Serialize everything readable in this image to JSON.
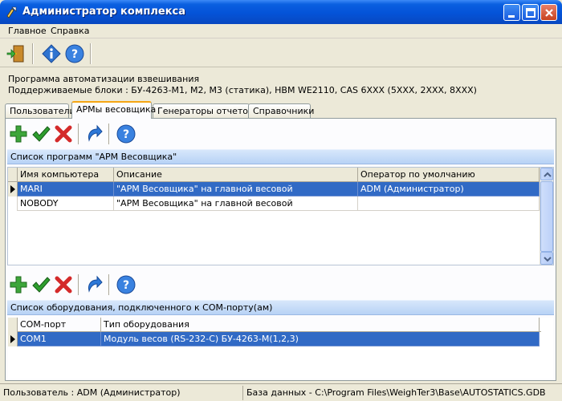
{
  "window": {
    "title": "Администратор комплекса"
  },
  "menu": {
    "items": [
      "Главное",
      "Справка"
    ]
  },
  "info": {
    "line1": "Программа автоматизации взвешивания",
    "line2": "Поддерживаемые блоки : БУ-4263-М1, М2, М3 (статика), HBM WE2110, CAS 6XXX (5XXX, 2XXX, 8XXX)"
  },
  "tabs": [
    {
      "label": "Пользователи"
    },
    {
      "label": "АРМы весовщика"
    },
    {
      "label": "Генераторы отчетов"
    },
    {
      "label": "Справочники"
    }
  ],
  "programs": {
    "title": "Список программ \"АРМ Весовщика\"",
    "columns": [
      "Имя компьютера",
      "Описание",
      "Оператор по умолчанию"
    ],
    "rows": [
      [
        "MARI",
        "\"АРМ Весовщика\" на главной весовой",
        "ADM (Администратор)"
      ],
      [
        "NOBODY",
        "\"АРМ Весовщика\" на главной весовой",
        ""
      ]
    ]
  },
  "equipment": {
    "title": "Список оборудования, подключенного к COM-порту(ам)",
    "columns": [
      "COM-порт",
      "Тип оборудования"
    ],
    "rows": [
      [
        "COM1",
        "Модуль весов (RS-232-C) БУ-4263-М(1,2,3)"
      ]
    ]
  },
  "status": {
    "user": "Пользователь : ADM (Администратор)",
    "database": "База данных - C:\\Program Files\\WeighTer3\\Base\\AUTOSTATICS.GDB"
  },
  "colors": {
    "titlebar": "#0453d8",
    "selection": "#316ac5",
    "section_header": "#c6dcf8",
    "add_icon": "#3da63a",
    "apply_icon": "#2e9e2e",
    "delete_icon": "#d42a2a",
    "help_icon": "#2f74d0"
  },
  "icons": {
    "main_toolbar": [
      "exit-door-icon",
      "info-icon",
      "help-icon"
    ],
    "grid_toolbar": [
      "add-icon",
      "apply-check-icon",
      "delete-icon",
      "refresh-icon",
      "help-icon"
    ]
  }
}
